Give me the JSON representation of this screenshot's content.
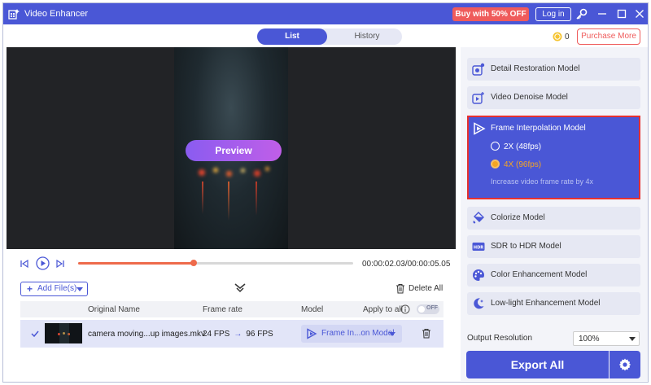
{
  "window": {
    "title": "Video Enhancer",
    "buy_label": "Buy with 50% OFF",
    "login_label": "Log in"
  },
  "tabs": [
    {
      "label": "List",
      "active": true
    },
    {
      "label": "History",
      "active": false
    }
  ],
  "account": {
    "coins": "0",
    "purchase_label": "Purchase More"
  },
  "preview": {
    "button_label": "Preview"
  },
  "player": {
    "time": "00:00:02.03/00:00:05.05",
    "progress": 0.42
  },
  "file_actions": {
    "add_label": "Add File(s)",
    "delete_all_label": "Delete All"
  },
  "table": {
    "headers": {
      "name": "Original Name",
      "frame_rate": "Frame rate",
      "model": "Model",
      "apply_all": "Apply to all"
    },
    "toggle_label": "OFF",
    "rows": [
      {
        "name": "camera moving...up images.mkv",
        "fps_from": "24 FPS",
        "fps_to": "96 FPS",
        "model": "Frame In...on Model"
      }
    ]
  },
  "models": [
    {
      "label": "Detail Restoration Model",
      "icon": "detail-restoration-icon"
    },
    {
      "label": "Video Denoise Model",
      "icon": "denoise-icon"
    },
    {
      "label": "Frame Interpolation Model",
      "icon": "frame-interpolation-icon",
      "active": true
    },
    {
      "label": "Colorize Model",
      "icon": "colorize-icon"
    },
    {
      "label": "SDR to HDR Model",
      "icon": "hdr-icon"
    },
    {
      "label": "Color Enhancement Model",
      "icon": "palette-icon"
    },
    {
      "label": "Low-light Enhancement Model",
      "icon": "moon-icon"
    }
  ],
  "interpolation": {
    "options": [
      {
        "label": "2X (48fps)",
        "selected": false
      },
      {
        "label": "4X (96fps)",
        "selected": true
      }
    ],
    "hint": "Increase video frame rate by 4x"
  },
  "output": {
    "label": "Output Resolution",
    "value": "100%"
  },
  "export_label": "Export All",
  "colors": {
    "accent": "#4a57d6",
    "buy": "#ef5b5b",
    "progress": "#ee6a4b",
    "selected_option": "#f5a524",
    "highlight_border": "#e53030"
  }
}
